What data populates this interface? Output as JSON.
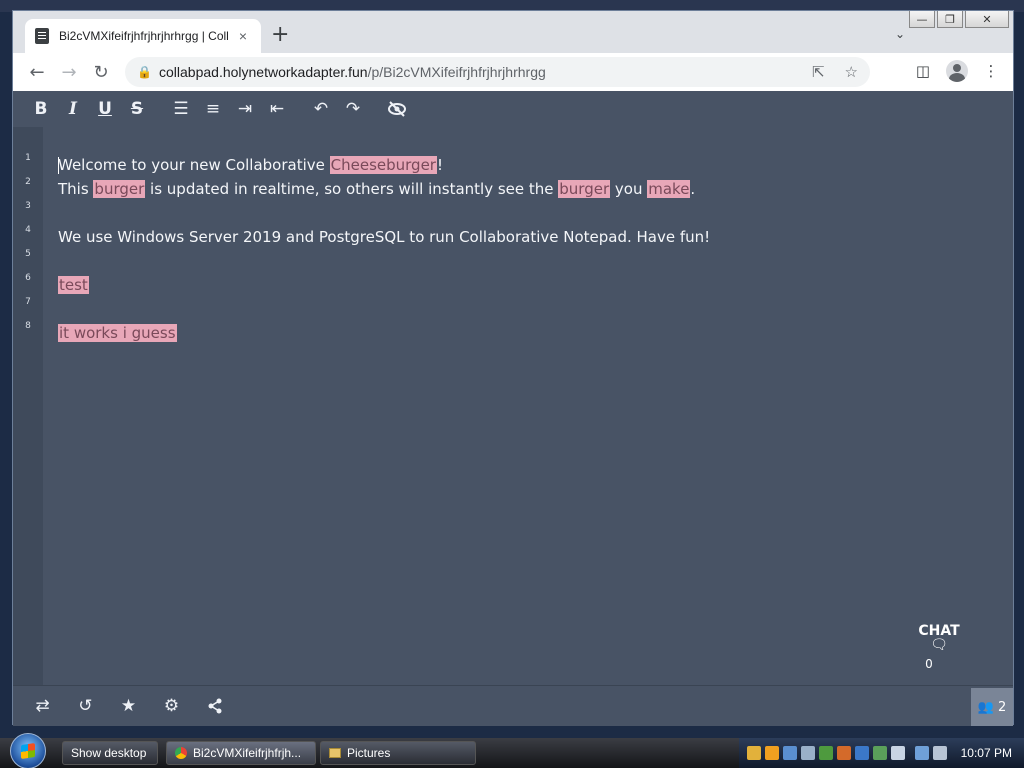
{
  "browser": {
    "tab_title": "Bi2cVMXifeifrjhfrjhrjhrhrgg | Coll",
    "tab_close": "×",
    "new_tab": "+",
    "url_host": "collabpad.holynetworkadapter.fun",
    "url_path": "/p/Bi2cVMXifeifrjhfrjhrjhrhrgg"
  },
  "editor": {
    "line_numbers": [
      "1",
      "2",
      "3",
      "4",
      "5",
      "6",
      "7",
      "8"
    ],
    "line1": {
      "pre": "Welcome to your new Collaborative ",
      "hl": "Cheeseburger",
      "post": "!"
    },
    "line2": {
      "a": "This ",
      "hl1": "burger",
      "b": " is updated in realtime, so others will instantly see the ",
      "hl2": "burger",
      "c": " you ",
      "hl3": "make",
      "d": "."
    },
    "line4": "We use Windows Server 2019 and PostgreSQL to run Collaborative Notepad. Have fun!",
    "line6": "test",
    "line8": "it works i guess"
  },
  "chat": {
    "label": "CHAT",
    "count": "0"
  },
  "users": {
    "count": "2"
  },
  "taskbar": {
    "show_desktop": "Show desktop",
    "window1": "Bi2cVMXifeifrjhfrjh...",
    "window2": "Pictures",
    "clock": "10:07 PM"
  },
  "icons": {
    "bold": "B",
    "italic": "I",
    "underline": "U",
    "strike": "S",
    "undo": "↶",
    "redo": "↷"
  },
  "colors": {
    "editor_bg": "#485365",
    "highlight": "#e8a7b8"
  }
}
